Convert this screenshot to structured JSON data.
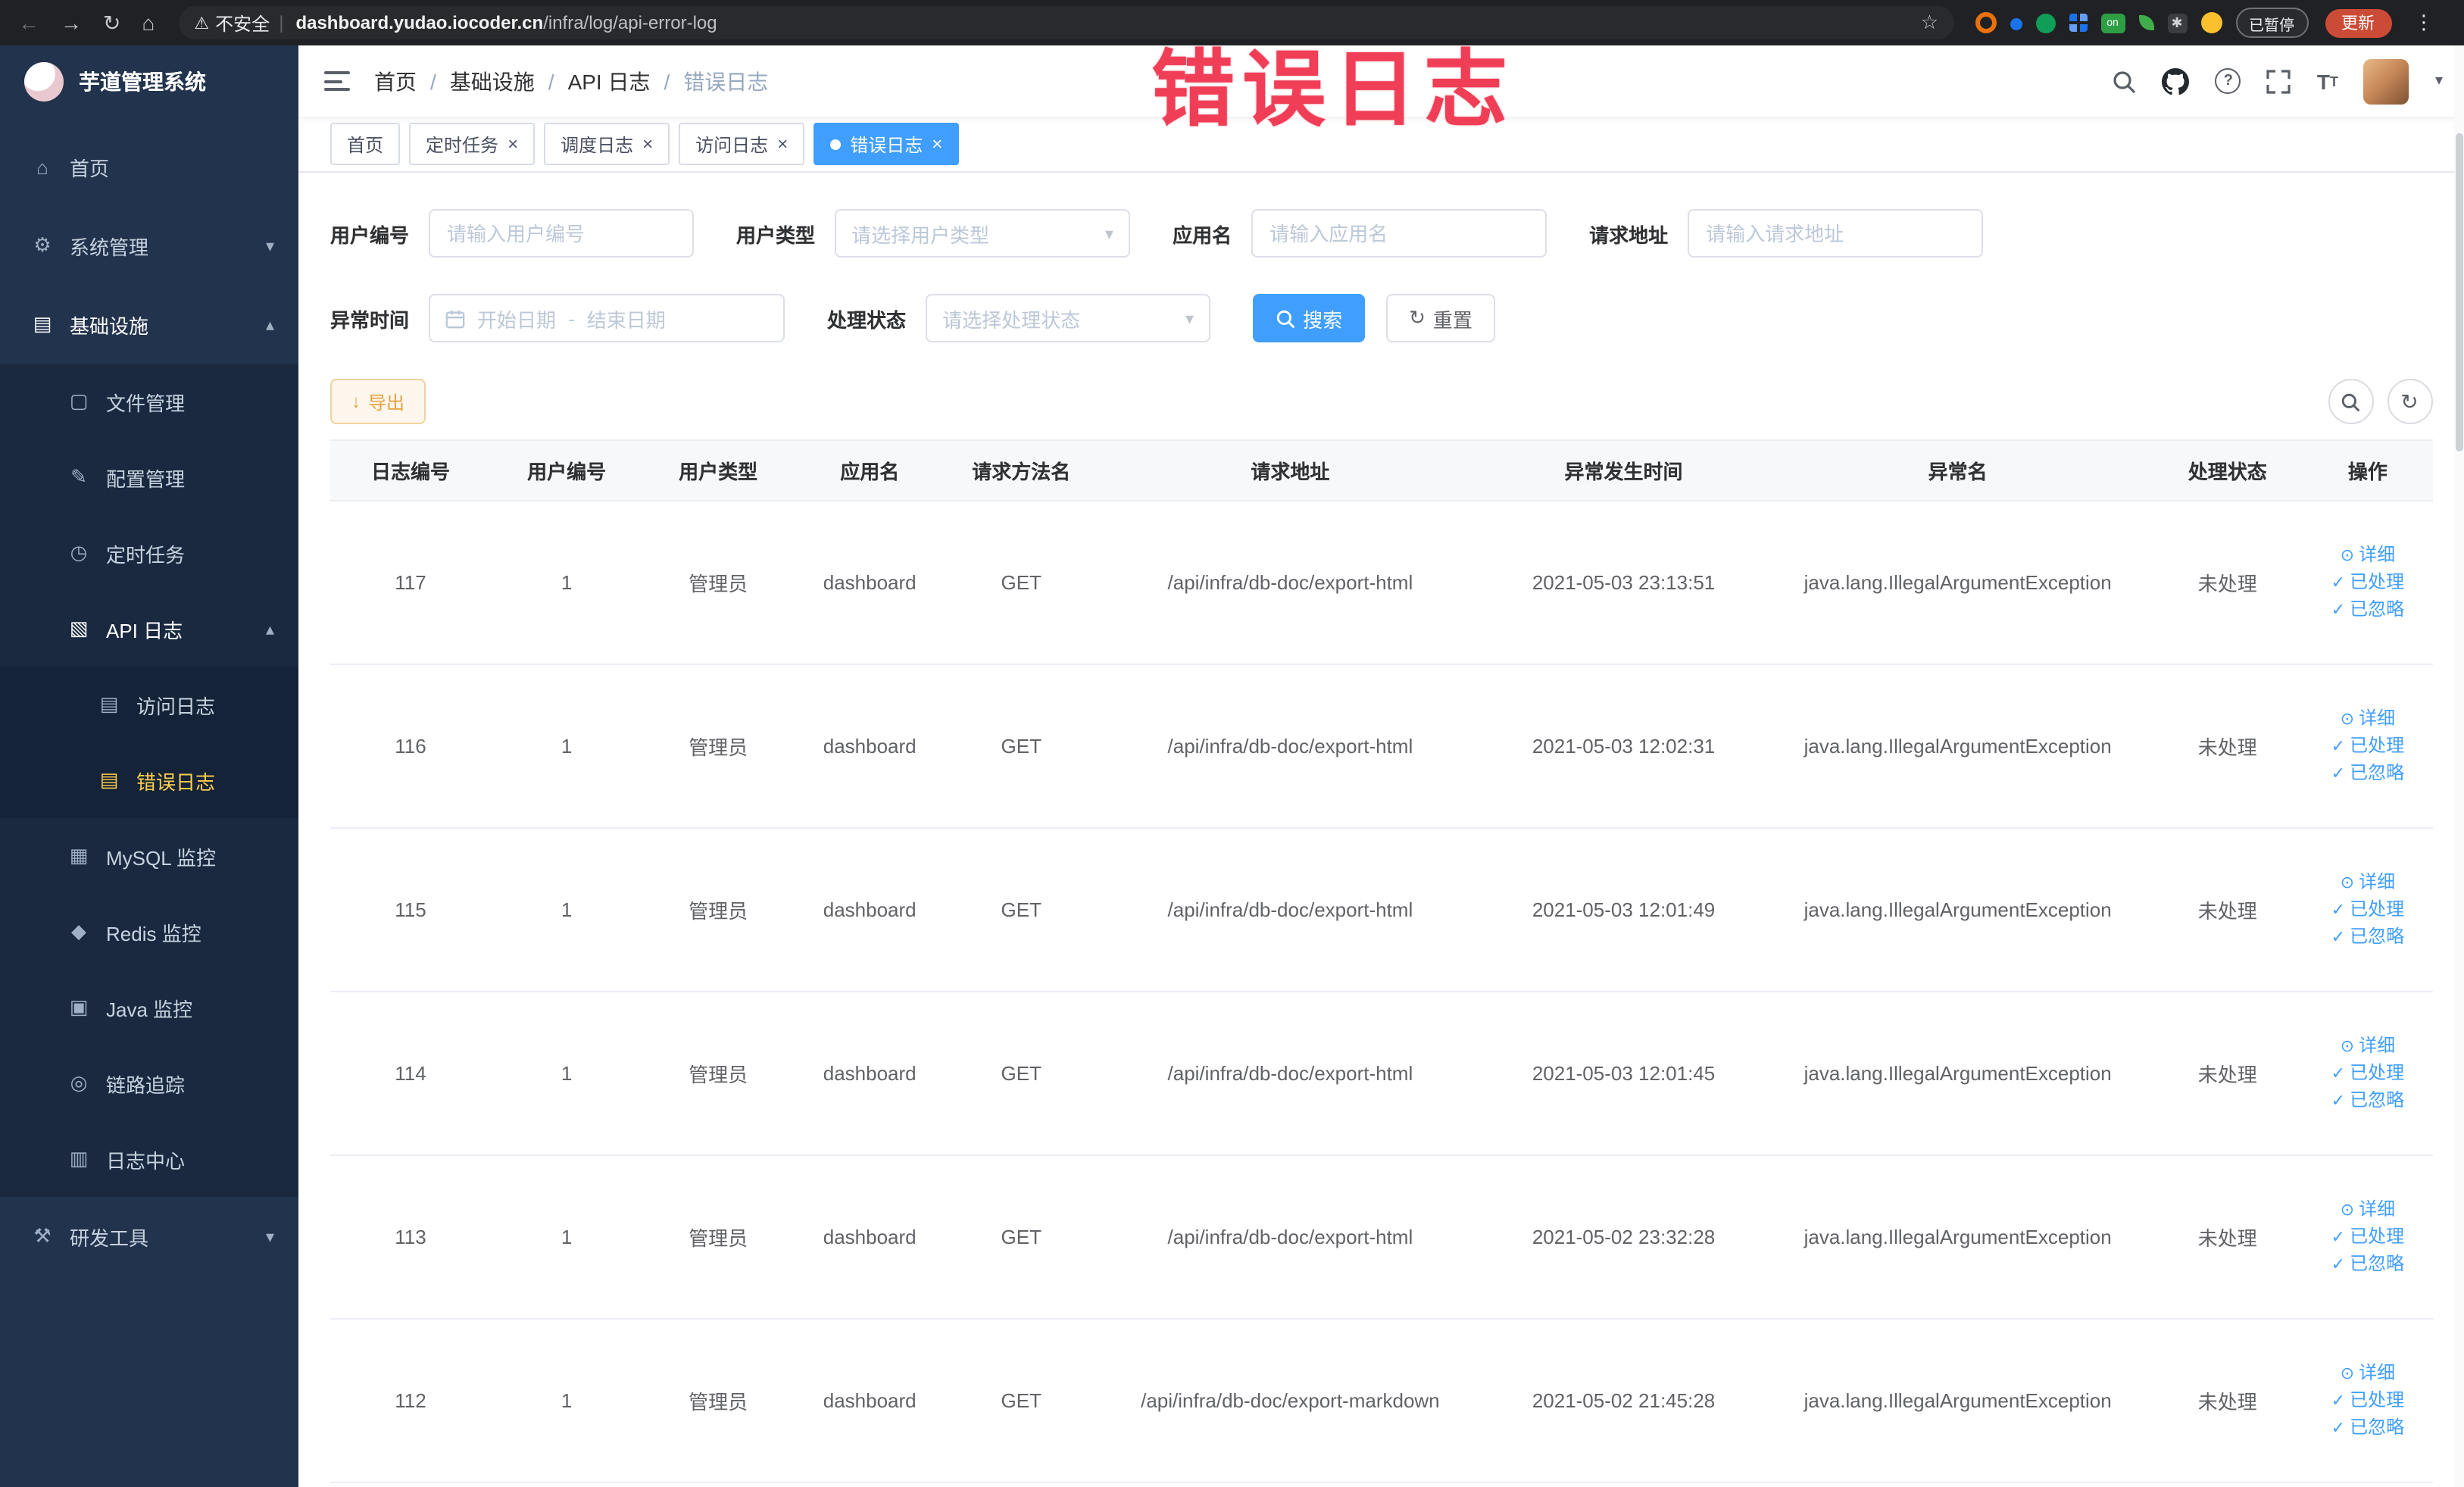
{
  "watermark": {
    "text": "错误日志"
  },
  "browser": {
    "security_label": "不安全",
    "url_domain": "dashboard.yudao.iocoder.cn",
    "url_path": "/infra/log/api-error-log",
    "on_badge": "on",
    "paused_label": "已暂停",
    "update_label": "更新"
  },
  "icons": {
    "back": "←",
    "forward": "→",
    "reload": "↻",
    "home": "⌂",
    "warning": "⚠",
    "star": "☆",
    "menu_dots": "⋮",
    "asterisk": "✱",
    "caret_down": "▾",
    "chev_down": "▾",
    "chev_up": "▴",
    "check": "✓",
    "eye": "⊙",
    "download": "↓",
    "refresh": "↻",
    "close": "×",
    "question": "?",
    "font_size_big": "T",
    "font_size_small": "T"
  },
  "sidebar": {
    "logo_title": "芋道管理系统",
    "items": [
      {
        "label": "首页",
        "icon": "⌂"
      },
      {
        "label": "系统管理",
        "icon": "⚙"
      },
      {
        "label": "基础设施",
        "icon": "▤"
      },
      {
        "label": "文件管理",
        "icon": "▢"
      },
      {
        "label": "配置管理",
        "icon": "✎"
      },
      {
        "label": "定时任务",
        "icon": "◷"
      },
      {
        "label": "API 日志",
        "icon": "▧"
      },
      {
        "label": "访问日志",
        "icon": "▤"
      },
      {
        "label": "错误日志",
        "icon": "▤"
      },
      {
        "label": "MySQL 监控",
        "icon": "▦"
      },
      {
        "label": "Redis 监控",
        "icon": "◆"
      },
      {
        "label": "Java 监控",
        "icon": "▣"
      },
      {
        "label": "链路追踪",
        "icon": "◎"
      },
      {
        "label": "日志中心",
        "icon": "▥"
      },
      {
        "label": "研发工具",
        "icon": "⚒"
      }
    ]
  },
  "header": {
    "breadcrumb": [
      "首页",
      "基础设施",
      "API 日志",
      "错误日志"
    ],
    "separator": "/"
  },
  "tabs": [
    {
      "label": "首页"
    },
    {
      "label": "定时任务"
    },
    {
      "label": "调度日志"
    },
    {
      "label": "访问日志"
    },
    {
      "label": "错误日志"
    }
  ],
  "filters": {
    "user_id": {
      "label": "用户编号",
      "placeholder": "请输入用户编号",
      "value": ""
    },
    "user_type": {
      "label": "用户类型",
      "placeholder": "请选择用户类型"
    },
    "app_name": {
      "label": "应用名",
      "placeholder": "请输入应用名",
      "value": ""
    },
    "request_url": {
      "label": "请求地址",
      "placeholder": "请输入请求地址",
      "value": ""
    },
    "exception_time": {
      "label": "异常时间",
      "start_placeholder": "开始日期",
      "separator": "-",
      "end_placeholder": "结束日期"
    },
    "process_status": {
      "label": "处理状态",
      "placeholder": "请选择处理状态"
    },
    "search_label": "搜索",
    "reset_label": "重置"
  },
  "toolbar": {
    "export_label": "导出"
  },
  "table": {
    "columns": [
      "日志编号",
      "用户编号",
      "用户类型",
      "应用名",
      "请求方法名",
      "请求地址",
      "异常发生时间",
      "异常名",
      "处理状态",
      "操作"
    ],
    "actions": {
      "detail": "详细",
      "processed": "已处理",
      "ignored": "已忽略"
    },
    "rows": [
      {
        "id": "117",
        "user_id": "1",
        "user_type": "管理员",
        "app": "dashboard",
        "method": "GET",
        "url": "/api/infra/db-doc/export-html",
        "time": "2021-05-03 23:13:51",
        "exception": "java.lang.IllegalArgumentException",
        "status": "未处理"
      },
      {
        "id": "116",
        "user_id": "1",
        "user_type": "管理员",
        "app": "dashboard",
        "method": "GET",
        "url": "/api/infra/db-doc/export-html",
        "time": "2021-05-03 12:02:31",
        "exception": "java.lang.IllegalArgumentException",
        "status": "未处理"
      },
      {
        "id": "115",
        "user_id": "1",
        "user_type": "管理员",
        "app": "dashboard",
        "method": "GET",
        "url": "/api/infra/db-doc/export-html",
        "time": "2021-05-03 12:01:49",
        "exception": "java.lang.IllegalArgumentException",
        "status": "未处理"
      },
      {
        "id": "114",
        "user_id": "1",
        "user_type": "管理员",
        "app": "dashboard",
        "method": "GET",
        "url": "/api/infra/db-doc/export-html",
        "time": "2021-05-03 12:01:45",
        "exception": "java.lang.IllegalArgumentException",
        "status": "未处理"
      },
      {
        "id": "113",
        "user_id": "1",
        "user_type": "管理员",
        "app": "dashboard",
        "method": "GET",
        "url": "/api/infra/db-doc/export-html",
        "time": "2021-05-02 23:32:28",
        "exception": "java.lang.IllegalArgumentException",
        "status": "未处理"
      },
      {
        "id": "112",
        "user_id": "1",
        "user_type": "管理员",
        "app": "dashboard",
        "method": "GET",
        "url": "/api/infra/db-doc/export-markdown",
        "time": "2021-05-02 21:45:28",
        "exception": "java.lang.IllegalArgumentException",
        "status": "未处理"
      }
    ]
  },
  "colors": {
    "accent": "#409eff",
    "sidebar_active": "#ffd04b",
    "warning": "#e6a23c",
    "watermark": "#f03e57"
  }
}
